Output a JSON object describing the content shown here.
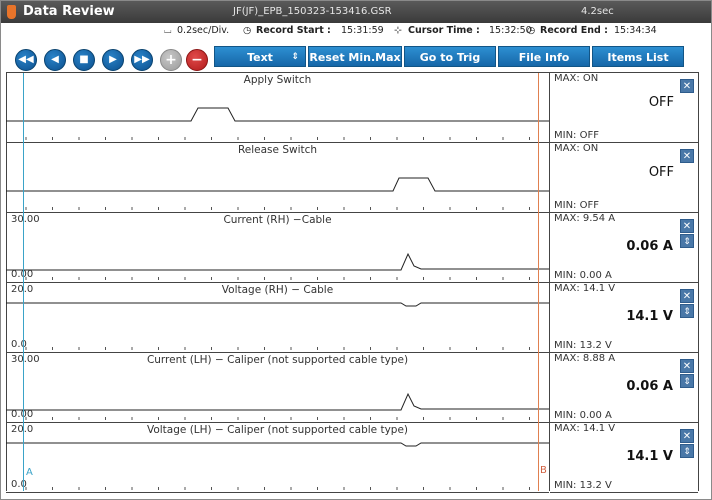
{
  "titlebar": {
    "app_title": "Data Review",
    "file_name": "JF(JF)_EPB_150323-153416.GSR",
    "duration": "4.2sec"
  },
  "info": {
    "time_div": "0.2sec/Div.",
    "record_start_label": "Record Start :",
    "record_start": "15:31:59",
    "cursor_time_label": "Cursor Time :",
    "cursor_time": "15:32:50",
    "record_end_label": "Record End :",
    "record_end": "15:34:34"
  },
  "toolbar": {
    "text_select": "Text",
    "reset_minmax": "Reset Min.Max",
    "go_to_trig": "Go to Trig",
    "file_info": "File Info",
    "items_list": "Items List",
    "add_symbol": "+",
    "remove_symbol": "−"
  },
  "cursors": {
    "a_label": "A",
    "b_label": "B"
  },
  "channels": [
    {
      "title": "Apply Switch",
      "y_max": "",
      "y_min": "",
      "max": "MAX: ON",
      "min": "MIN: OFF",
      "value": "OFF",
      "bold": false
    },
    {
      "title": "Release Switch",
      "y_max": "",
      "y_min": "",
      "max": "MAX: ON",
      "min": "MIN: OFF",
      "value": "OFF",
      "bold": false
    },
    {
      "title": "Current (RH) −Cable",
      "y_max": "30.00",
      "y_min": "0.00",
      "max": "MAX:  9.54 A",
      "min": "MIN:  0.00 A",
      "value": "0.06 A",
      "bold": true
    },
    {
      "title": "Voltage (RH) − Cable",
      "y_max": "20.0",
      "y_min": "0.0",
      "max": "MAX:  14.1 V",
      "min": "MIN:  13.2 V",
      "value": "14.1 V",
      "bold": true
    },
    {
      "title": "Current (LH) − Caliper (not supported cable type)",
      "y_max": "30.00",
      "y_min": "0.00",
      "max": "MAX:  8.88 A",
      "min": "MIN:  0.00 A",
      "value": "0.06 A",
      "bold": true
    },
    {
      "title": "Voltage (LH) − Caliper (not supported cable type)",
      "y_max": "20.0",
      "y_min": "0.0",
      "max": "MAX:  14.1 V",
      "min": "MIN:  13.2 V",
      "value": "14.1 V",
      "bold": true
    }
  ]
}
